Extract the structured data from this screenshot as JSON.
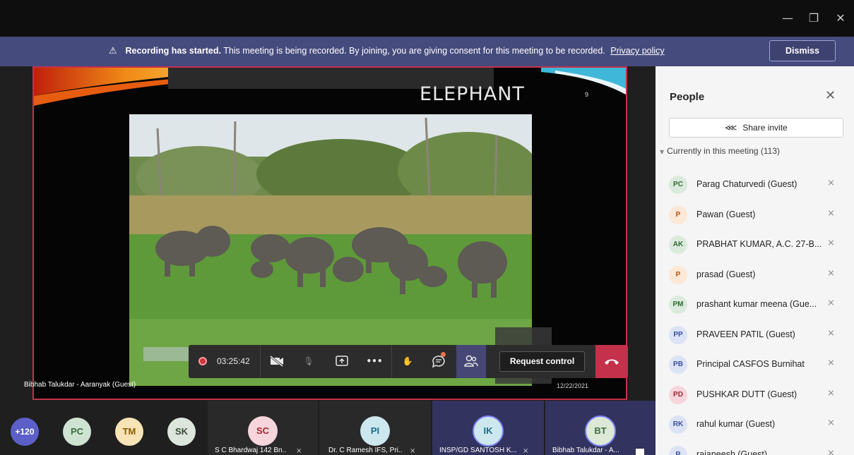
{
  "window": {
    "minimize_icon": "minimize-icon",
    "restore_icon": "restore-icon",
    "close_icon": "close-icon"
  },
  "banner": {
    "bold_text": "Recording has started.",
    "text": "This meeting is being recorded. By joining, you are giving consent for this meeting to be recorded.",
    "link": "Privacy policy",
    "dismiss_label": "Dismiss",
    "bg_color": "#464b7d"
  },
  "slide": {
    "title": "ELEPHANT",
    "number": "9",
    "date": "12/22/2021",
    "presenter": "Bibhab Talukdar - Aaranyak (Guest)"
  },
  "controls": {
    "timer": "03:25:42",
    "request_control_label": "Request control",
    "hangup_color": "#c4314b"
  },
  "strip": {
    "overflow": "+120",
    "avatars": [
      {
        "initials": "PC",
        "color": "#cfe3d2",
        "text": "#3b6e40"
      },
      {
        "initials": "TM",
        "color": "#f7e3b5",
        "text": "#8a5a00"
      },
      {
        "initials": "SK",
        "color": "#dce6dc",
        "text": "#3a4a3a"
      }
    ],
    "tiles": [
      {
        "initials": "SC",
        "name": "S C Bhardwaj 142 Bn...",
        "color": "#f6d5dd",
        "text": "#a4262c"
      },
      {
        "initials": "PI",
        "name": "Dr. C Ramesh IFS, Pri...",
        "color": "#cde7ef",
        "text": "#1a6f87"
      },
      {
        "initials": "IK",
        "name": "INSP/GD SANTOSH K...",
        "color": "#cde7ef",
        "text": "#1a6f87"
      },
      {
        "initials": "BT",
        "name": "Bibhab Talukdar - A...",
        "color": "#dde9d6",
        "text": "#3b6e40"
      }
    ]
  },
  "people": {
    "title": "People",
    "share_label": "Share invite",
    "section": "Currently in this meeting (113)",
    "list": [
      {
        "initials": "PC",
        "name": "Parag Chaturvedi (Guest)",
        "bg": "#dbeadc",
        "fg": "#2f6b36"
      },
      {
        "initials": "P",
        "name": "Pawan (Guest)",
        "bg": "#fde7d6",
        "fg": "#b3541e"
      },
      {
        "initials": "AK",
        "name": "PRABHAT KUMAR, A.C. 27-B...",
        "bg": "#dbeadc",
        "fg": "#2f6b36"
      },
      {
        "initials": "P",
        "name": "prasad (Guest)",
        "bg": "#fde7d6",
        "fg": "#b3541e"
      },
      {
        "initials": "PM",
        "name": "prashant kumar meena (Gue...",
        "bg": "#dbeadc",
        "fg": "#2f6b36"
      },
      {
        "initials": "PP",
        "name": "PRAVEEN PATIL (Guest)",
        "bg": "#dce3f5",
        "fg": "#3b4f9e"
      },
      {
        "initials": "PB",
        "name": "Principal CASFOS Burnihat",
        "bg": "#dce3f5",
        "fg": "#3b4f9e"
      },
      {
        "initials": "PD",
        "name": "PUSHKAR DUTT (Guest)",
        "bg": "#f6d5dd",
        "fg": "#a4262c"
      },
      {
        "initials": "RK",
        "name": "rahul kumar (Guest)",
        "bg": "#dce3f5",
        "fg": "#3b4f9e"
      },
      {
        "initials": "R",
        "name": "rajaneesh (Guest)",
        "bg": "#dce3f5",
        "fg": "#3b4f9e"
      }
    ]
  }
}
